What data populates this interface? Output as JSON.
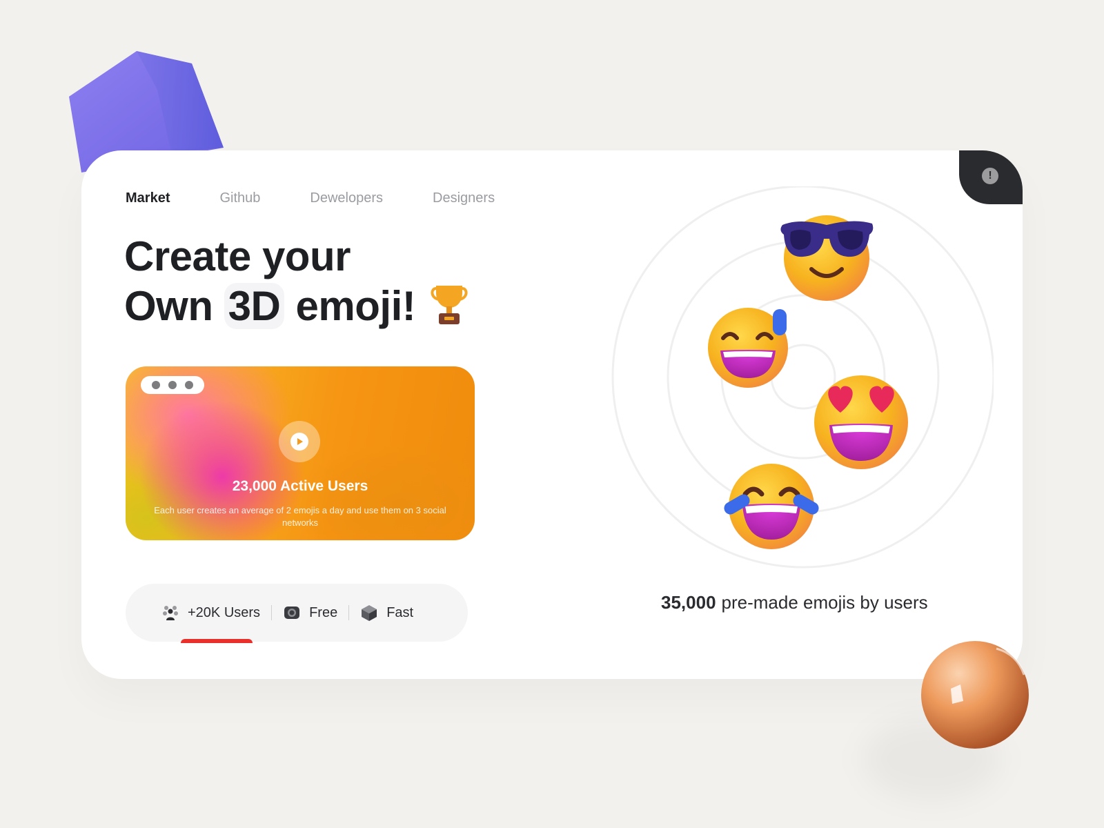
{
  "nav": {
    "tabs": [
      "Market",
      "Github",
      "Dewelopers",
      "Designers"
    ],
    "active": "Market"
  },
  "hero": {
    "line1": "Create your",
    "line2_start": "Own",
    "line2_highlight": "3D",
    "line2_end": "emoji!"
  },
  "video": {
    "title": "23,000 Active Users",
    "description": "Each user creates an average of 2 emojis a day and use them on 3 social networks",
    "toolbar_icons": [
      "play-icon",
      "grid-icon",
      "info-icon"
    ]
  },
  "stats": [
    {
      "label": "+20K Users",
      "icon": "users-icon"
    },
    {
      "label": "Free",
      "icon": "camera-icon"
    },
    {
      "label": "Fast",
      "icon": "cube-icon"
    }
  ],
  "premade": {
    "count": "35,000",
    "label": "pre-made emojis by users"
  },
  "emojis": [
    "sunglasses-emoji",
    "sweat-smile-emoji",
    "heart-eyes-emoji",
    "tears-of-joy-emoji"
  ],
  "colors": {
    "accent_highlight": "#f6b940",
    "dark": "#1f2024",
    "cube": "#7a6fe8",
    "ball": "#e9905a"
  }
}
